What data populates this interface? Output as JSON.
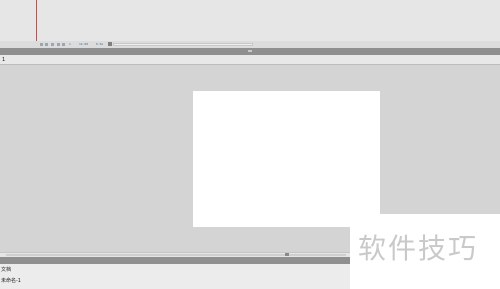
{
  "timeline": {
    "frame_number": "1",
    "fps": "12.00",
    "time": "0.0s"
  },
  "edit_bar": {
    "scene_label": "1"
  },
  "properties": {
    "doc_label": "文档",
    "doc_name": "未命名-1"
  },
  "watermark": {
    "text": "软件技巧"
  },
  "colors": {
    "playhead": "#d04a4a",
    "stage": "#ffffff",
    "pasteboard": "#d4d4d4"
  }
}
